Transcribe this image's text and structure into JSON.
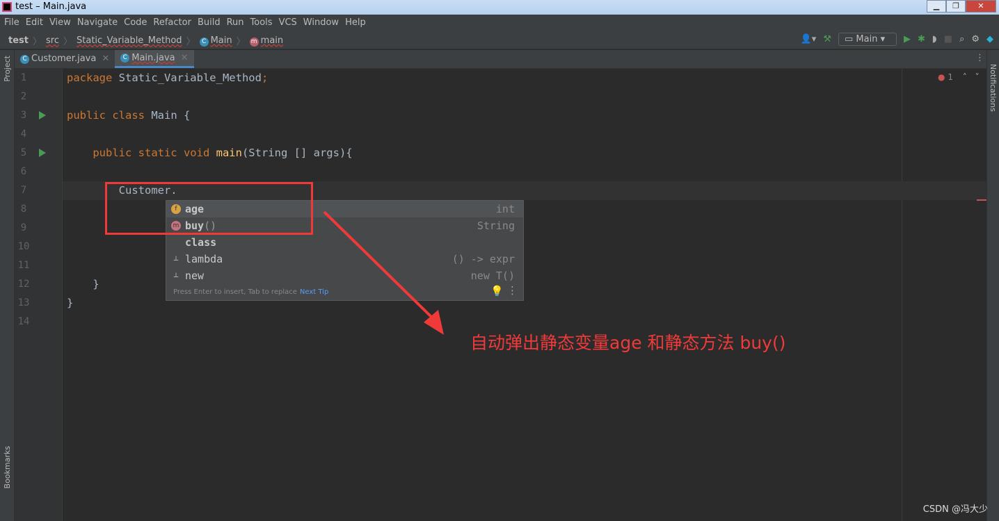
{
  "window": {
    "title": "test – Main.java",
    "min": "▁",
    "max": "❐",
    "close": "✕"
  },
  "menu": [
    "File",
    "Edit",
    "View",
    "Navigate",
    "Code",
    "Refactor",
    "Build",
    "Run",
    "Tools",
    "VCS",
    "Window",
    "Help"
  ],
  "breadcrumb": {
    "project": "test",
    "src": "src",
    "package": "Static_Variable_Method",
    "class": "Main",
    "method": "main"
  },
  "toolbar": {
    "run_config": "Main"
  },
  "tabs": [
    {
      "label": "Customer.java"
    },
    {
      "label": "Main.java",
      "active": true
    }
  ],
  "side": {
    "project": "Project",
    "bookmarks": "Bookmarks",
    "notifications": "Notifications"
  },
  "inspections": {
    "errors": "1"
  },
  "code": [
    {
      "n": "1",
      "parts": [
        [
          "kw",
          "package "
        ],
        [
          "tx",
          "Static_Variable_Method"
        ],
        [
          "kw",
          ";"
        ]
      ]
    },
    {
      "n": "2",
      "parts": []
    },
    {
      "n": "3",
      "parts": [
        [
          "kw",
          "public class "
        ],
        [
          "tx",
          "Main {"
        ]
      ],
      "run": true
    },
    {
      "n": "4",
      "parts": []
    },
    {
      "n": "5",
      "parts": [
        [
          "kw",
          "    public static void "
        ],
        [
          "fn",
          "main"
        ],
        [
          "tx",
          "(String [] args){"
        ]
      ],
      "run": true
    },
    {
      "n": "6",
      "parts": []
    },
    {
      "n": "7",
      "parts": [
        [
          "tx",
          "        Customer."
        ]
      ],
      "current": true
    },
    {
      "n": "8",
      "parts": []
    },
    {
      "n": "9",
      "parts": []
    },
    {
      "n": "10",
      "parts": []
    },
    {
      "n": "11",
      "parts": []
    },
    {
      "n": "12",
      "parts": [
        [
          "tx",
          "    }"
        ]
      ]
    },
    {
      "n": "13",
      "parts": [
        [
          "tx",
          "}"
        ]
      ]
    },
    {
      "n": "14",
      "parts": []
    }
  ],
  "completion": {
    "items": [
      {
        "name": "age",
        "suffix": "",
        "type": "int",
        "icon": "field-icon",
        "glyph": "f",
        "color": "#d9a343"
      },
      {
        "name": "buy",
        "suffix": "()",
        "type": "String",
        "icon": "method-icon",
        "glyph": "m",
        "color": "#c5737f"
      },
      {
        "name": "class",
        "suffix": "",
        "type": "",
        "icon": "",
        "glyph": "",
        "color": ""
      },
      {
        "name": "lambda",
        "suffix": "",
        "type": "() -> expr",
        "icon": "template-icon",
        "glyph": "⊥",
        "color": ""
      },
      {
        "name": "new",
        "suffix": "",
        "type": "new T()",
        "icon": "template-icon",
        "glyph": "⊥",
        "color": ""
      }
    ],
    "hint": "Press Enter to insert, Tab to replace",
    "next_tip": "Next Tip"
  },
  "annotation": "自动弹出静态变量age 和静态方法 buy()",
  "watermark": "CSDN @冯大少"
}
